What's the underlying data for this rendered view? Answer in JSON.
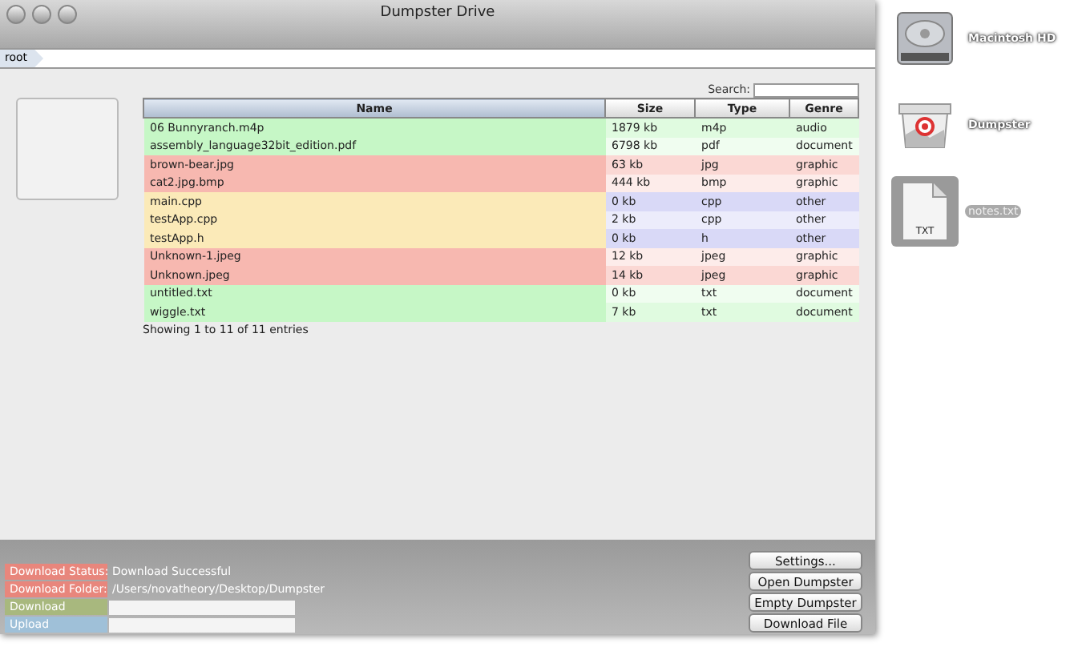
{
  "window": {
    "title": "Dumpster Drive"
  },
  "path_bar": {
    "crumb": "root"
  },
  "search": {
    "label": "Search:"
  },
  "table": {
    "columns": [
      "Name",
      "Size",
      "Type",
      "Genre"
    ],
    "rows": [
      {
        "name": "06 Bunnyranch.m4p",
        "size": "1879 kb",
        "type": "m4p",
        "genre": "audio",
        "color": "#c6f7c6"
      },
      {
        "name": "assembly_language32bit_edition.pdf",
        "size": "6798 kb",
        "type": "pdf",
        "genre": "document",
        "color": "#c6f7c6"
      },
      {
        "name": "brown-bear.jpg",
        "size": "63 kb",
        "type": "jpg",
        "genre": "graphic",
        "color": "#f7b8b0"
      },
      {
        "name": "cat2.jpg.bmp",
        "size": "444 kb",
        "type": "bmp",
        "genre": "graphic",
        "color": "#f7b8b0"
      },
      {
        "name": "main.cpp",
        "size": "0 kb",
        "type": "cpp",
        "genre": "other",
        "color": "#fbeab8"
      },
      {
        "name": "testApp.cpp",
        "size": "2 kb",
        "type": "cpp",
        "genre": "other",
        "color": "#fbeab8"
      },
      {
        "name": "testApp.h",
        "size": "0 kb",
        "type": "h",
        "genre": "other",
        "color": "#fbeab8"
      },
      {
        "name": "Unknown-1.jpeg",
        "size": "12 kb",
        "type": "jpeg",
        "genre": "graphic",
        "color": "#f7b8b0"
      },
      {
        "name": "Unknown.jpeg",
        "size": "14 kb",
        "type": "jpeg",
        "genre": "graphic",
        "color": "#f7b8b0"
      },
      {
        "name": "untitled.txt",
        "size": "0 kb",
        "type": "txt",
        "genre": "document",
        "color": "#c6f7c6"
      },
      {
        "name": "wiggle.txt",
        "size": "7 kb",
        "type": "txt",
        "genre": "document",
        "color": "#c6f7c6"
      }
    ],
    "info": "Showing 1 to 11 of 11 entries"
  },
  "status": [
    {
      "kind": "text",
      "label": "Download Status:",
      "value": "Download Successful"
    },
    {
      "kind": "text",
      "label": "Download Folder:",
      "value": "/Users/novatheory/Desktop/Dumpster"
    },
    {
      "kind": "bar",
      "label": "Download",
      "level": 0
    },
    {
      "kind": "bar",
      "label": "Upload",
      "level": 0
    }
  ],
  "buttons": [
    "Settings...",
    "Open Dumpster",
    "Empty Dumpster",
    "Download File"
  ],
  "desktop": [
    {
      "kind": "drive",
      "label": "Macintosh HD",
      "selected": false
    },
    {
      "kind": "dumpster",
      "label": "Dumpster",
      "selected": false
    },
    {
      "kind": "file",
      "label": "notes.txt",
      "badge": "TXT",
      "selected": true
    }
  ]
}
